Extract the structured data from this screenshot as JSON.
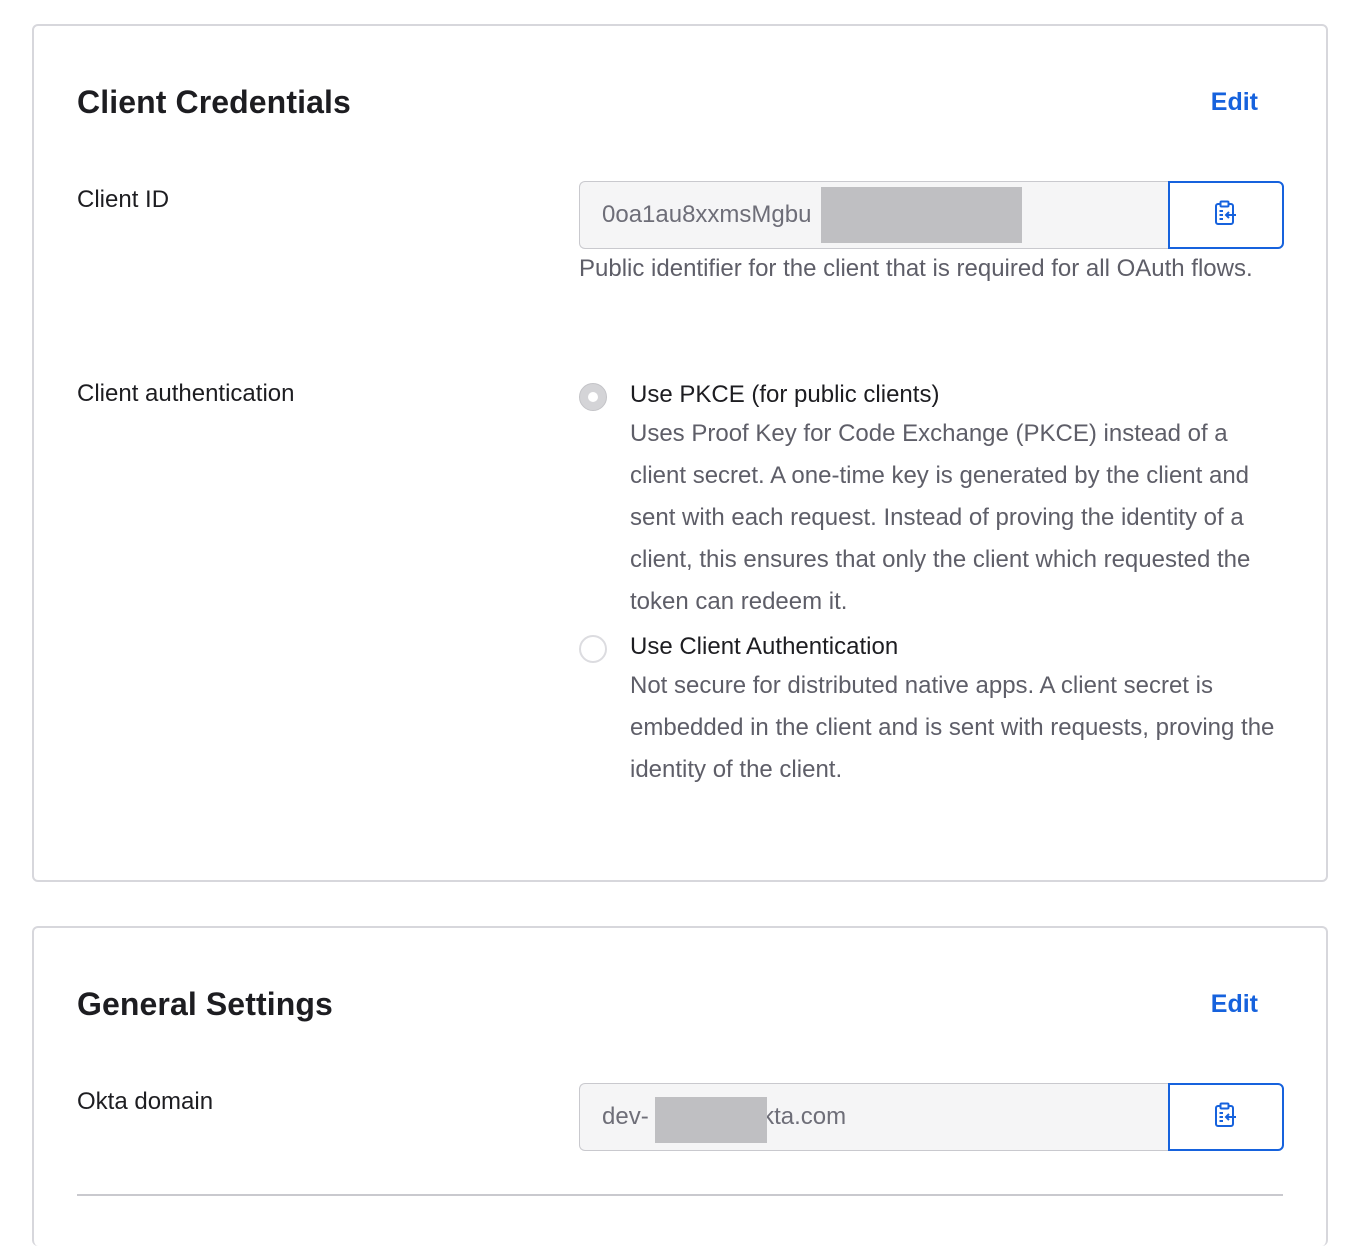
{
  "client_credentials": {
    "title": "Client Credentials",
    "edit_label": "Edit",
    "client_id": {
      "label": "Client ID",
      "value": "0oa1au8xxmsMgbu",
      "copy_icon": "clipboard-icon",
      "help": "Public identifier for the client that is required for all OAuth flows."
    },
    "client_authentication": {
      "label": "Client authentication",
      "options": [
        {
          "label": "Use PKCE (for public clients)",
          "description": "Uses Proof Key for Code Exchange (PKCE) instead of a client secret. A one-time key is generated by the client and sent with each request. Instead of proving the identity of a client, this ensures that only the client which requested the token can redeem it.",
          "selected": true
        },
        {
          "label": "Use Client Authentication",
          "description": "Not secure for distributed native apps. A client secret is embedded in the client and is sent with requests, proving the identity of the client.",
          "selected": false
        }
      ]
    }
  },
  "general_settings": {
    "title": "General Settings",
    "edit_label": "Edit",
    "okta_domain": {
      "label": "Okta domain",
      "value": "dev-            4.okta.com",
      "copy_icon": "clipboard-icon"
    }
  },
  "colors": {
    "accent": "#1662dd",
    "border": "#d7d7dc",
    "field_bg": "#f5f5f6",
    "muted_text": "#5e5e68"
  }
}
